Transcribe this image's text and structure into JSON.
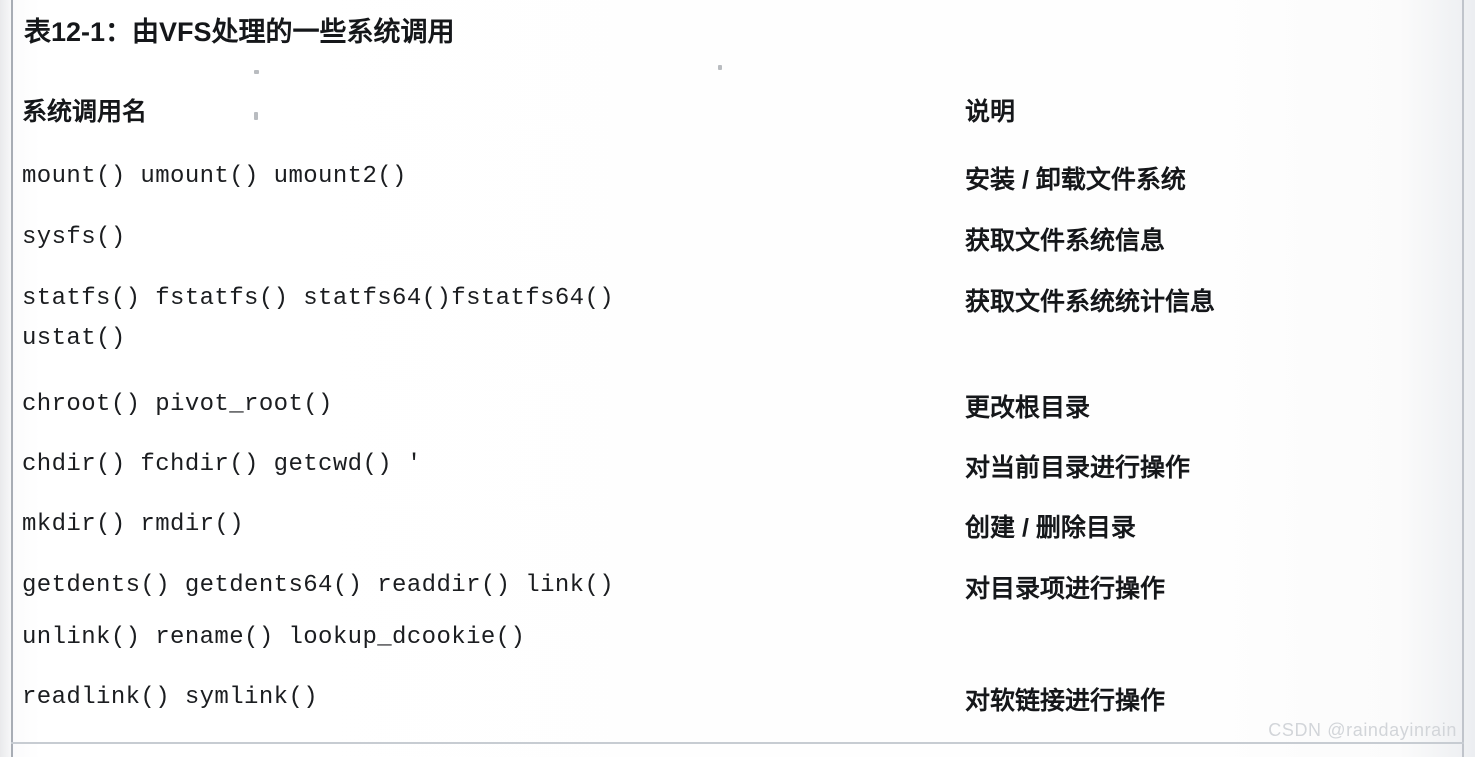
{
  "document": {
    "title": "表12-1：由VFS处理的一些系统调用",
    "watermark": "CSDN @raindayinrain"
  },
  "table": {
    "columns": [
      "系统调用名",
      "说明"
    ],
    "rows": [
      {
        "syscalls": "mount() umount() umount2()",
        "syscalls_lines": [
          "mount() umount() umount2()"
        ],
        "description": "安装 / 卸载文件系统"
      },
      {
        "syscalls": "sysfs()",
        "syscalls_lines": [
          "sysfs()"
        ],
        "description": "获取文件系统信息"
      },
      {
        "syscalls": "statfs() fstatfs() statfs64()fstatfs64() ustat()",
        "syscalls_lines": [
          "statfs() fstatfs() statfs64()fstatfs64()",
          "ustat()"
        ],
        "description": "获取文件系统统计信息"
      },
      {
        "syscalls": "chroot() pivot_root()",
        "syscalls_lines": [
          "chroot() pivot_root()"
        ],
        "description": "更改根目录"
      },
      {
        "syscalls": "chdir() fchdir() getcwd()",
        "syscalls_lines": [
          "chdir() fchdir() getcwd() '"
        ],
        "description": "对当前目录进行操作"
      },
      {
        "syscalls": "mkdir() rmdir()",
        "syscalls_lines": [
          "mkdir() rmdir()"
        ],
        "description": "创建 / 删除目录"
      },
      {
        "syscalls": "getdents() getdents64() readdir() link() unlink() rename() lookup_dcookie()",
        "syscalls_lines": [
          "getdents() getdents64() readdir() link()",
          "unlink() rename() lookup_dcookie()"
        ],
        "description": "对目录项进行操作"
      },
      {
        "syscalls": "readlink() symlink()",
        "syscalls_lines": [
          "readlink() symlink()"
        ],
        "description": "对软链接进行操作"
      }
    ]
  }
}
